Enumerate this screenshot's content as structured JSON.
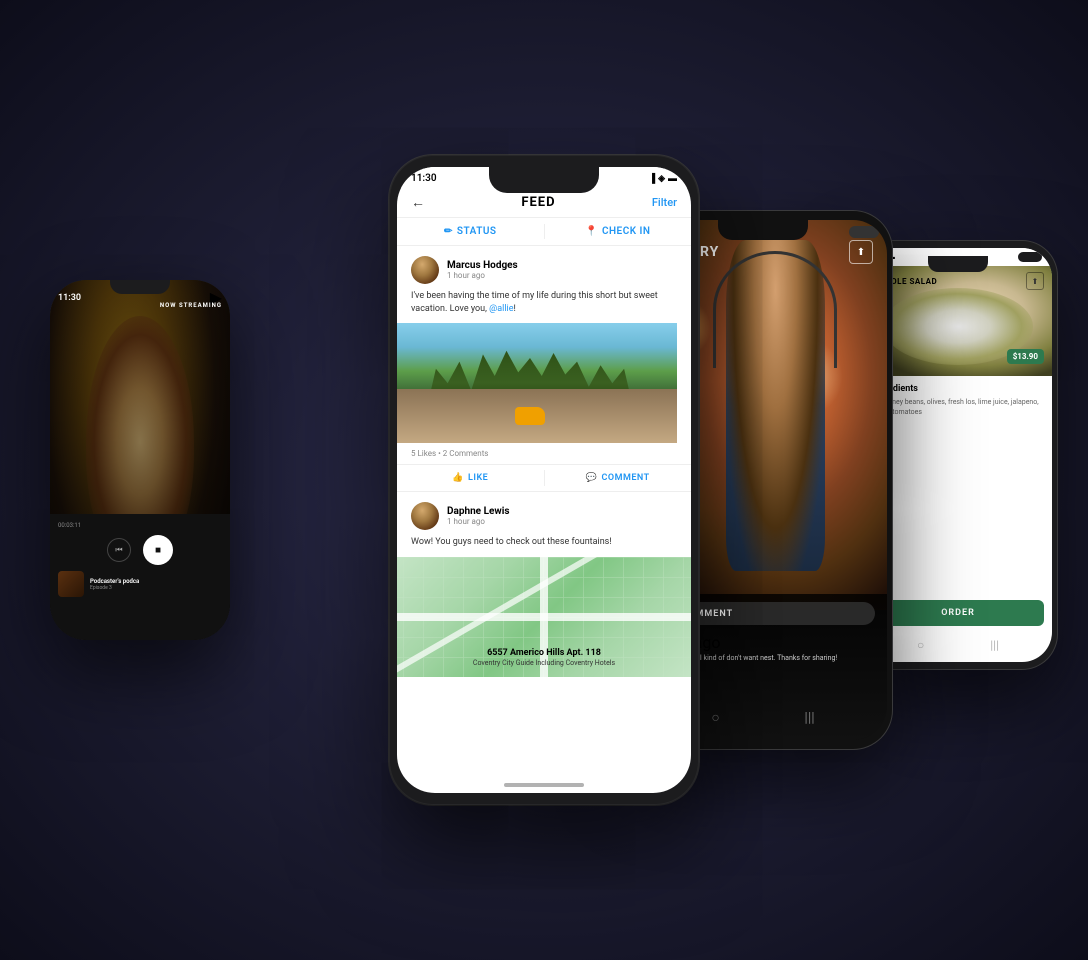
{
  "phones": {
    "left": {
      "time": "11:30",
      "now_streaming": "NOW STREAMING",
      "podcast_title": "Podcaster's podca",
      "podcast_episode": "Episode 3",
      "timer": "00:03:11"
    },
    "center": {
      "time": "11:30",
      "title": "FEED",
      "filter_label": "Filter",
      "tab_status": "STATUS",
      "tab_checkin": "CHECK IN",
      "post1": {
        "author": "Marcus Hodges",
        "time_ago": "1 hour ago",
        "text_prefix": "I've been having the time of my life during this short but sweet vacation. Love you, ",
        "mention": "@allie",
        "text_suffix": "!",
        "stats": "5 Likes • 2 Comments",
        "like_label": "LIKE",
        "comment_label": "COMMENT"
      },
      "post2": {
        "author": "Daphne Lewis",
        "time_ago": "1 hour ago",
        "text": "Wow! You guys need to check out these fountains!",
        "address_street": "6557 Americo Hills Apt. 118",
        "address_city": "Coventry City Guide Including Coventry Hotels"
      }
    },
    "gallery": {
      "title": "GALLERY",
      "comment_label": "COMMENT",
      "user": "dges",
      "ago": "ago",
      "comment_text": "s so inspiring! I kind of don't want nest. Thanks for sharing!"
    },
    "right": {
      "recipe_title": "CAMOLE SALAD",
      "price": "$13.90",
      "ingredients_title": "Ingredients",
      "ingredients_text": "on, kidney beans, olives, fresh los, lime juice, jalapeno, garlic, tomatoes",
      "order_label": "ORDER"
    }
  }
}
